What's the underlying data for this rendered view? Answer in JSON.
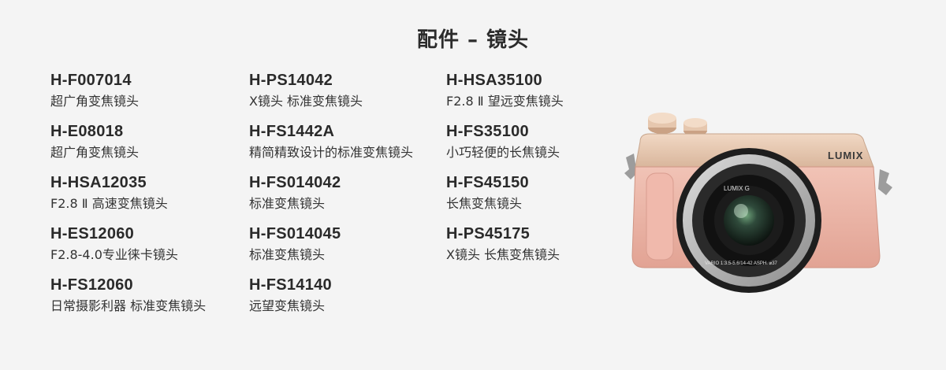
{
  "page": {
    "title": "配件 – 镜头"
  },
  "columns": [
    {
      "items": [
        {
          "model": "H-F007014",
          "desc": "超广角变焦镜头"
        },
        {
          "model": "H-E08018",
          "desc": "超广角变焦镜头"
        },
        {
          "model": "H-HSA12035",
          "desc": "F2.8 Ⅱ 高速变焦镜头"
        },
        {
          "model": "H-ES12060",
          "desc": "F2.8-4.0专业徕卡镜头"
        },
        {
          "model": "H-FS12060",
          "desc": "日常摄影利器 标准变焦镜头"
        }
      ]
    },
    {
      "items": [
        {
          "model": "H-PS14042",
          "desc": "X镜头 标准变焦镜头"
        },
        {
          "model": "H-FS1442A",
          "desc": "精简精致设计的标准变焦镜头"
        },
        {
          "model": "H-FS014042",
          "desc": "标准变焦镜头"
        },
        {
          "model": "H-FS014045",
          "desc": "标准变焦镜头"
        },
        {
          "model": "H-FS14140",
          "desc": "远望变焦镜头"
        }
      ]
    },
    {
      "items": [
        {
          "model": "H-HSA35100",
          "desc": "F2.8 Ⅱ 望远变焦镜头"
        },
        {
          "model": "H-FS35100",
          "desc": "小巧轻便的长焦镜头"
        },
        {
          "model": "H-FS45150",
          "desc": "长焦变焦镜头"
        },
        {
          "model": "H-PS45175",
          "desc": "X镜头 长焦变焦镜头"
        }
      ]
    }
  ],
  "camera": {
    "brand": "LUMIX",
    "lens_brand": "LUMIX G",
    "lens_marking": "VARIO 1:3.5-5.6/14-42 ASPH. ⌀37",
    "body_color": "#eab5a9",
    "top_color": "#e3c3ab",
    "lens_color": "#2a2a2a"
  }
}
